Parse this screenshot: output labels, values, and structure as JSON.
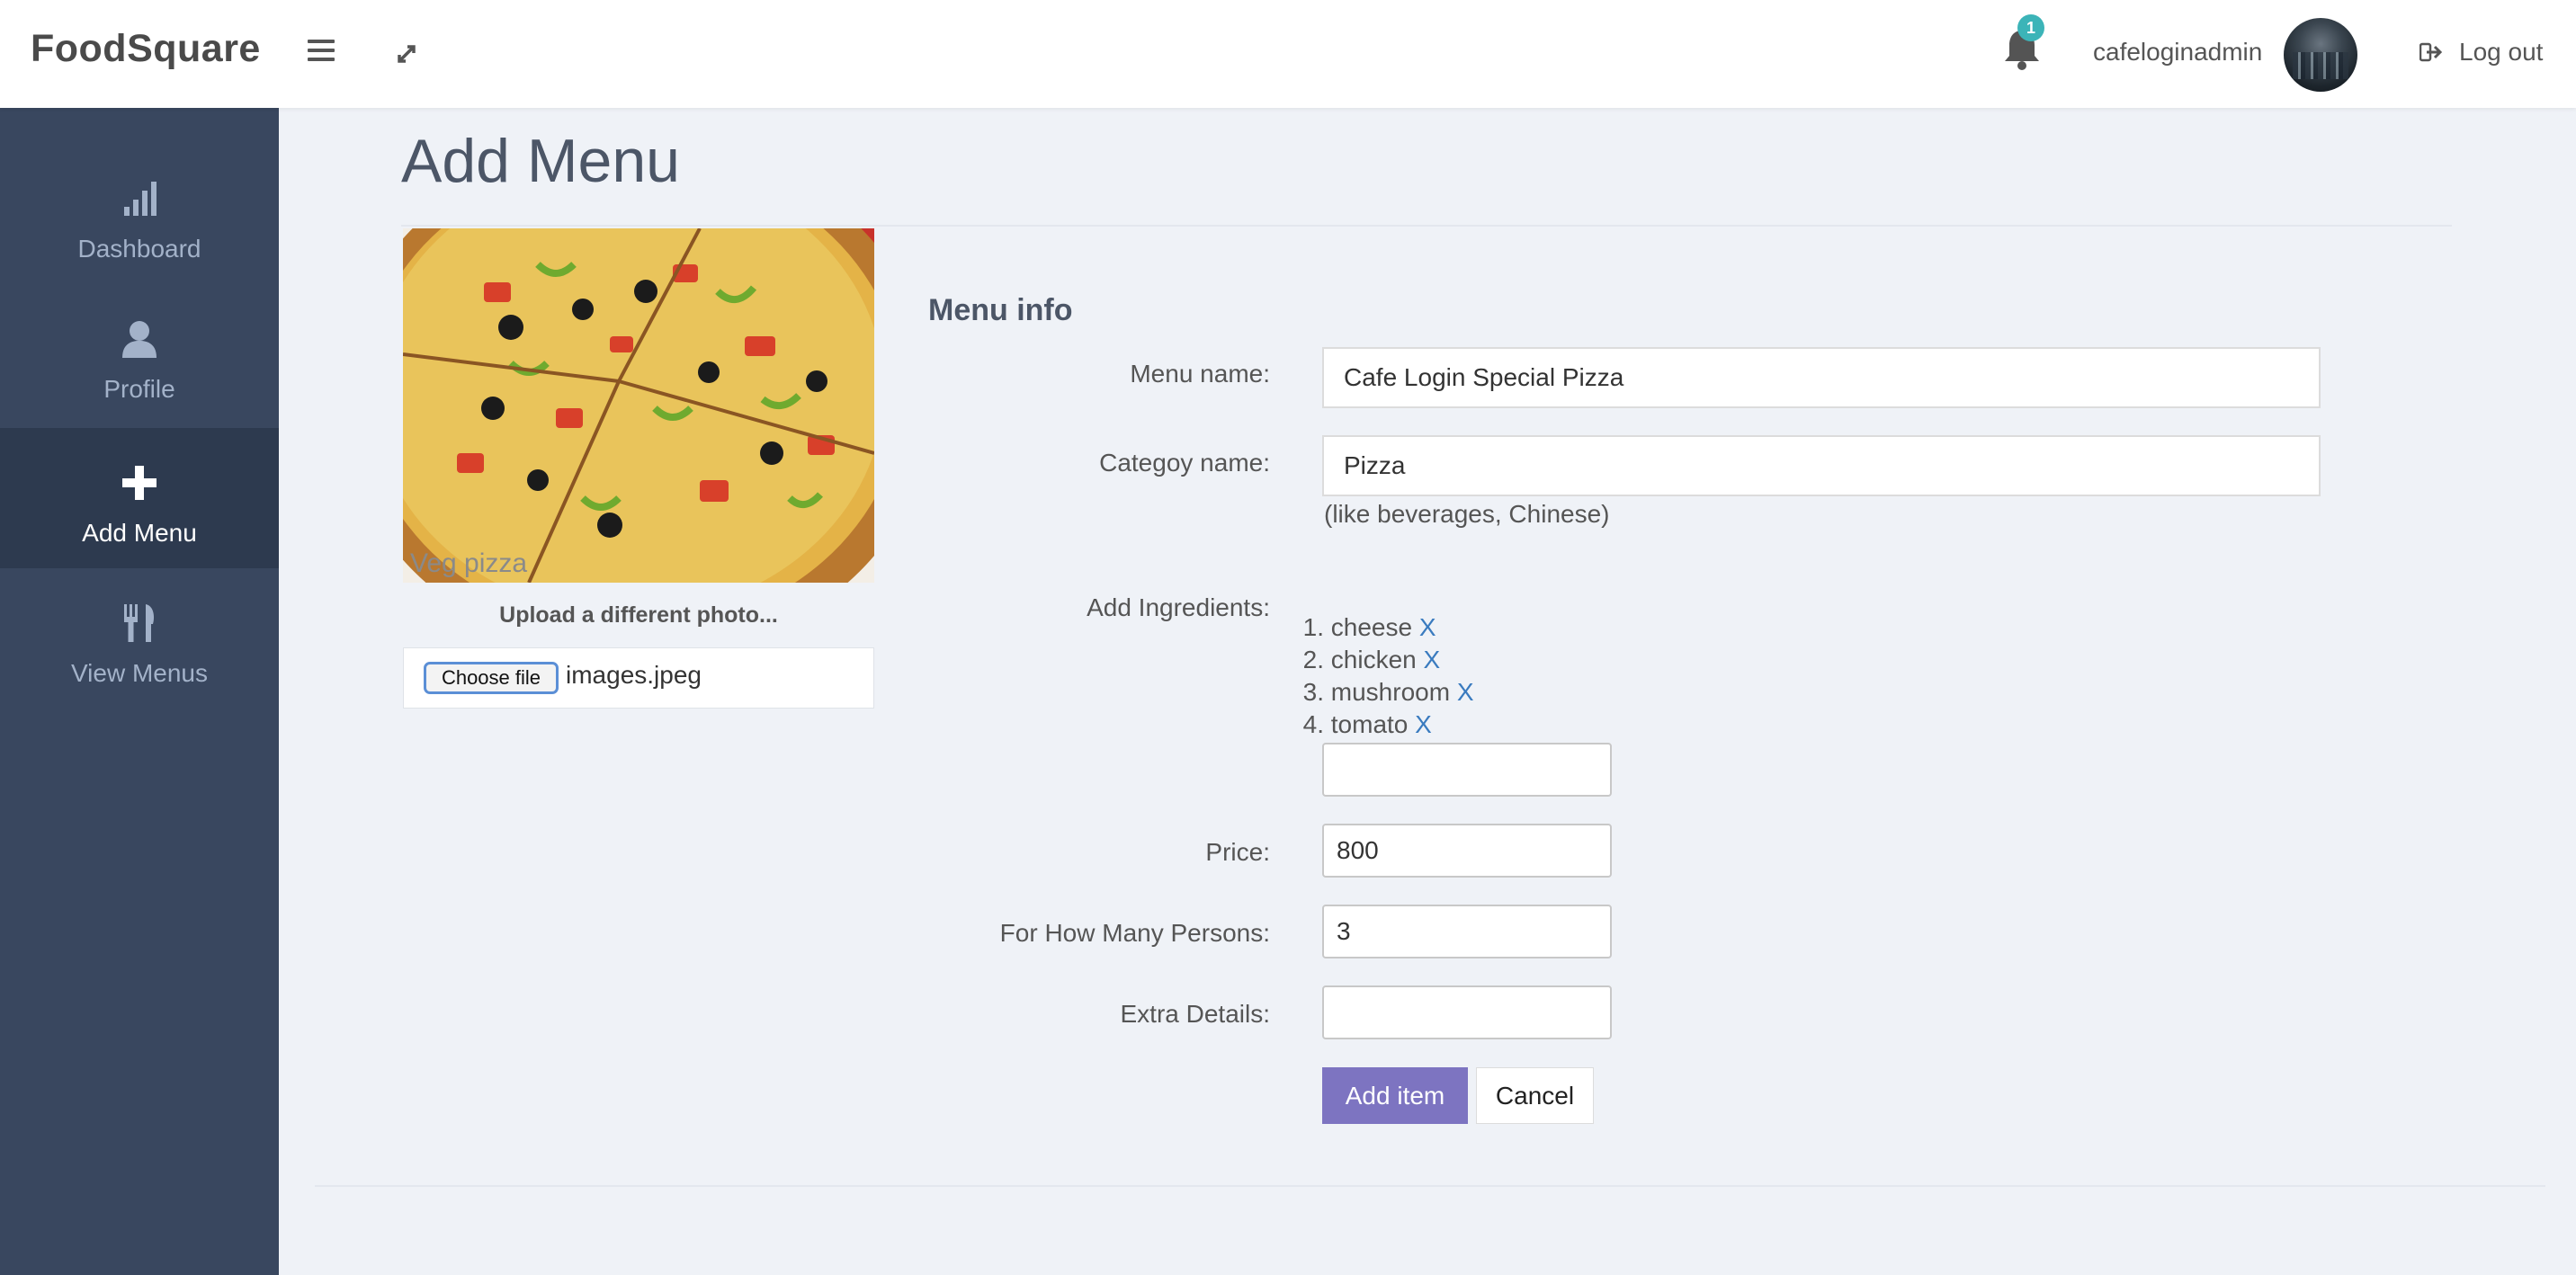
{
  "header": {
    "brand": "FoodSquare",
    "notification_count": "1",
    "username": "cafeloginadmin",
    "logout_label": "Log out"
  },
  "sidebar": {
    "items": [
      {
        "label": "Dashboard",
        "icon": "bar-chart-icon",
        "active": false
      },
      {
        "label": "Profile",
        "icon": "user-icon",
        "active": false
      },
      {
        "label": "Add Menu",
        "icon": "plus-icon",
        "active": true
      },
      {
        "label": "View Menus",
        "icon": "cutlery-icon",
        "active": false
      }
    ]
  },
  "page": {
    "title": "Add Menu"
  },
  "photo": {
    "watermark": "Veg pizza",
    "upload_caption": "Upload a different photo...",
    "choose_label": "Choose file",
    "file_name": "images.jpeg"
  },
  "form": {
    "section_title": "Menu info",
    "menu_name_label": "Menu name:",
    "menu_name_value": "Cafe Login Special Pizza",
    "category_label": "Categoy name:",
    "category_value": "Pizza",
    "category_hint": "(like beverages, Chinese)",
    "ingredients_label": "Add Ingredients:",
    "ingredients": [
      {
        "num": "1.",
        "name": "cheese",
        "remove": "X"
      },
      {
        "num": "2.",
        "name": "chicken",
        "remove": "X"
      },
      {
        "num": "3.",
        "name": "mushroom",
        "remove": "X"
      },
      {
        "num": "4.",
        "name": "tomato",
        "remove": "X"
      }
    ],
    "ingredient_input_value": "",
    "price_label": "Price:",
    "price_value": "800",
    "persons_label": "For How Many Persons:",
    "persons_value": "3",
    "extra_label": "Extra Details:",
    "extra_value": "",
    "add_button": "Add item",
    "cancel_button": "Cancel"
  },
  "colors": {
    "sidebar_bg": "#39475f",
    "sidebar_active_bg": "#2d3a4f",
    "accent_button": "#7d74c1",
    "badge": "#3cb4b8",
    "link": "#3a7bbf"
  }
}
